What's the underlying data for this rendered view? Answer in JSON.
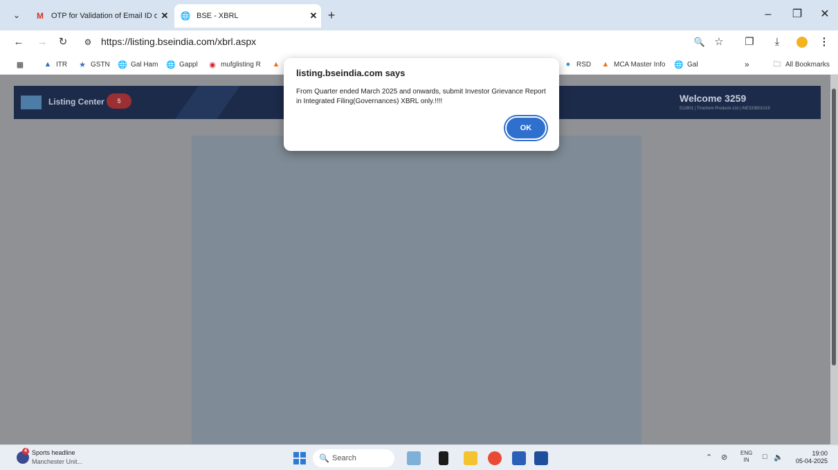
{
  "browser": {
    "tabs": [
      {
        "title": "OTP for Validation of Email ID of",
        "favicon": "gmail-icon",
        "active": false
      },
      {
        "title": "BSE - XBRL",
        "favicon": "globe-icon",
        "active": true
      }
    ],
    "url": "https://listing.bseindia.com/xbrl.aspx",
    "bookmarks": [
      {
        "label": "ITR",
        "icon": "itr-icon"
      },
      {
        "label": "GSTN",
        "icon": "gstn-icon"
      },
      {
        "label": "Gal Ham",
        "icon": "globe-icon"
      },
      {
        "label": "Gappl",
        "icon": "globe-icon"
      },
      {
        "label": "mufglisting R",
        "icon": "mufg-icon"
      },
      {
        "label": "",
        "icon": "mca-icon"
      },
      {
        "label": "RSD",
        "icon": "rsd-icon"
      },
      {
        "label": "MCA Master Info",
        "icon": "mca-icon"
      },
      {
        "label": "Gal",
        "icon": "globe-icon"
      }
    ],
    "all_bookmarks": "All Bookmarks",
    "overflow": "»"
  },
  "page": {
    "header_title": "Listing Center",
    "header_badge": "5",
    "welcome": "Welcome 3259",
    "welcome_sub": "512801 | Triochem Products Ltd | INE333B01019"
  },
  "dialog": {
    "title": "listing.bseindia.com says",
    "message": "From Quarter ended March 2025 and onwards, submit Investor Grievance Report in Integrated Filing(Governances) XBRL only.!!!!",
    "ok_label": "OK"
  },
  "taskbar": {
    "news_headline": "Sports headline",
    "news_sub": "Manchester Unit...",
    "news_badge": "4",
    "search_placeholder": "Search",
    "lang_line1": "ENG",
    "lang_line2": "IN",
    "time": "19:00",
    "date": "05-04-2025"
  }
}
